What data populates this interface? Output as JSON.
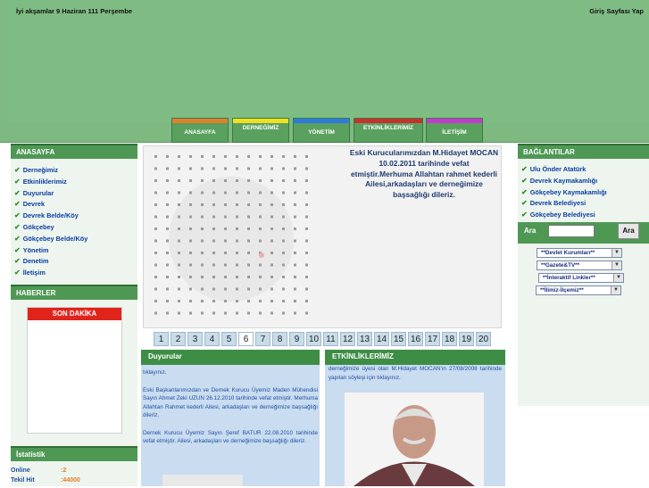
{
  "header": {
    "greeting": "İyi akşamlar 9 Haziran 111 Perşembe",
    "home_link": "Giriş Sayfası Yap"
  },
  "nav": {
    "tabs": [
      {
        "label": "ANASAYFA",
        "cap_color": "#e07f2e"
      },
      {
        "label": "DERNEĞİMİZ",
        "cap_color": "#f0e020"
      },
      {
        "label": "YÖNETİM",
        "cap_color": "#2d7be0"
      },
      {
        "label": "ETKİNLİKLERİMİZ",
        "cap_color": "#c8302e"
      },
      {
        "label": "İLETİŞİM",
        "cap_color": "#c43ad0"
      }
    ]
  },
  "left": {
    "anasayfa_title": "ANASAYFA",
    "menu": [
      "Derneğimiz",
      "Etkinliklerimiz",
      "Duyurular",
      "Devrek",
      "Devrek Belde/Köy",
      "Gökçebey",
      "Gökçebey Belde/Köy",
      "Yönetim",
      "Denetim",
      "İletişim"
    ],
    "haberler_title": "HABERLER",
    "son_dakika": "SON DAKİKA",
    "istatistik_title": "İstatistik",
    "stats": [
      {
        "label": "Online",
        "value": ":2"
      },
      {
        "label": "Tekil Hit",
        "value": ":44000"
      }
    ]
  },
  "slider": {
    "text": "Eski Kurucularımızdan M.Hidayet MOCAN 10.02.2011 tarihinde vefat etmiştir.Merhuma Allahtan rahmet kederli Ailesi,arkadaşları ve derneğimize başsağlığı dileriz.",
    "pages": [
      "1",
      "2",
      "3",
      "4",
      "5",
      "6",
      "7",
      "8",
      "9",
      "10",
      "11",
      "12",
      "13",
      "14",
      "15",
      "16",
      "17",
      "18",
      "19",
      "20"
    ],
    "active_page": "6"
  },
  "duyurular": {
    "title": "Duyurular",
    "p0": "tıklayınız.",
    "p1": "Eski Başkanlarımızdan ve Dernek Kurucu Üyemiz Maden Mühendisi Sayın Ahmet Zeki UZUN 26.12.2010 tarihinde vefat etmiştir. Merhuma Allahtan Rahmet kederli Ailesi, arkadaşları ve derneğimize başsağlığı dileriz.",
    "p2": "Dernek Kurucu Üyemiz Sayın Şeref BATUR 22.08.2010 tarihinde vefat etmiştir. Ailesi, arkadaşları ve derneğimize başsağlığı dileriz."
  },
  "etkinlik": {
    "title": "ETKİNLİKLERİMİZ",
    "text": "derneğimize üyesi olan M.Hidayet MOCAN'ın 27/08/2008 tarihinde yapılan söyleşi için tıklayınız."
  },
  "right": {
    "title": "BAĞLANTILAR",
    "links": [
      "Ulu Önder Atatürk",
      "Devrek Kaymakamlığı",
      "Gökçebey Kaymakamlığı",
      "Devrek Belediyesi",
      "Gökçebey Belediyesi"
    ],
    "search_label": "Ara",
    "search_value": "",
    "search_button": "Ara",
    "selects": [
      "**Devlet Kurumları**",
      "**Gazete&TV**",
      "**İnteraktif Linkler**",
      "**İlimiz-İlçemiz**"
    ]
  }
}
